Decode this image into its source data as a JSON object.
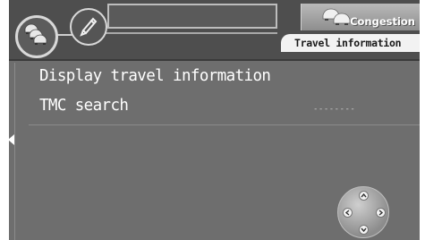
{
  "header": {
    "congestion_label": "Congestion",
    "travel_info_tab": "Travel information"
  },
  "menu": {
    "items": [
      {
        "label": "Display travel information"
      },
      {
        "label": "TMC search",
        "value": "--------"
      }
    ]
  },
  "icons": {
    "traffic_button": "traffic-cars-icon",
    "edit_button": "pencil-icon",
    "congestion_tab": "car-queue-icon",
    "scroll": "left-arrow-icon",
    "navigation": "joystick-icon"
  },
  "colors": {
    "panel_bg": "#6e6e6e",
    "header_bg": "#4e4e4e",
    "text": "#ffffff"
  }
}
